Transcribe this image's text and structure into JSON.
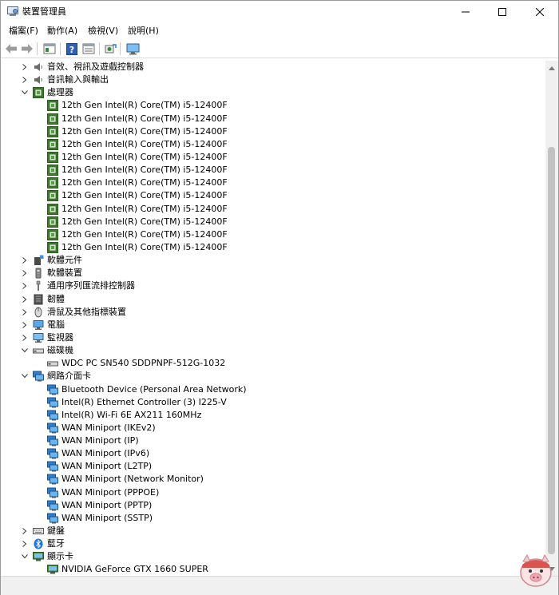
{
  "window": {
    "title": "裝置管理員",
    "minimize_glyph": "—",
    "maximize_glyph": "☐",
    "close_glyph": "✕"
  },
  "menu": [
    "檔案(F)",
    "動作(A)",
    "檢視(V)",
    "說明(H)"
  ],
  "toolbar": {
    "icons": [
      "back-arrow-icon",
      "forward-arrow-icon",
      "properties-icon",
      "help-icon",
      "view-icon",
      "scan-hardware-icon",
      "monitor-icon"
    ]
  },
  "tree": [
    {
      "label": "音效、視訊及遊戲控制器",
      "level": 0,
      "expanded": false,
      "icon": "speaker-icon"
    },
    {
      "label": "音訊輸入與輸出",
      "level": 0,
      "expanded": false,
      "icon": "speaker-icon"
    },
    {
      "label": "處理器",
      "level": 0,
      "expanded": true,
      "icon": "processor-icon"
    },
    {
      "label": "12th Gen Intel(R) Core(TM) i5-12400F",
      "level": 1,
      "icon": "processor-icon"
    },
    {
      "label": "12th Gen Intel(R) Core(TM) i5-12400F",
      "level": 1,
      "icon": "processor-icon"
    },
    {
      "label": "12th Gen Intel(R) Core(TM) i5-12400F",
      "level": 1,
      "icon": "processor-icon"
    },
    {
      "label": "12th Gen Intel(R) Core(TM) i5-12400F",
      "level": 1,
      "icon": "processor-icon"
    },
    {
      "label": "12th Gen Intel(R) Core(TM) i5-12400F",
      "level": 1,
      "icon": "processor-icon"
    },
    {
      "label": "12th Gen Intel(R) Core(TM) i5-12400F",
      "level": 1,
      "icon": "processor-icon"
    },
    {
      "label": "12th Gen Intel(R) Core(TM) i5-12400F",
      "level": 1,
      "icon": "processor-icon"
    },
    {
      "label": "12th Gen Intel(R) Core(TM) i5-12400F",
      "level": 1,
      "icon": "processor-icon"
    },
    {
      "label": "12th Gen Intel(R) Core(TM) i5-12400F",
      "level": 1,
      "icon": "processor-icon"
    },
    {
      "label": "12th Gen Intel(R) Core(TM) i5-12400F",
      "level": 1,
      "icon": "processor-icon"
    },
    {
      "label": "12th Gen Intel(R) Core(TM) i5-12400F",
      "level": 1,
      "icon": "processor-icon"
    },
    {
      "label": "12th Gen Intel(R) Core(TM) i5-12400F",
      "level": 1,
      "icon": "processor-icon"
    },
    {
      "label": "軟體元件",
      "level": 0,
      "expanded": false,
      "icon": "software-component-icon"
    },
    {
      "label": "軟體裝置",
      "level": 0,
      "expanded": false,
      "icon": "software-device-icon"
    },
    {
      "label": "通用序列匯流排控制器",
      "level": 0,
      "expanded": false,
      "icon": "usb-icon"
    },
    {
      "label": "韌體",
      "level": 0,
      "expanded": false,
      "icon": "firmware-icon"
    },
    {
      "label": "滑鼠及其他指標裝置",
      "level": 0,
      "expanded": false,
      "icon": "mouse-icon"
    },
    {
      "label": "電腦",
      "level": 0,
      "expanded": false,
      "icon": "computer-icon"
    },
    {
      "label": "監視器",
      "level": 0,
      "expanded": false,
      "icon": "monitor-icon"
    },
    {
      "label": "磁碟機",
      "level": 0,
      "expanded": true,
      "icon": "disk-drive-icon"
    },
    {
      "label": "WDC PC SN540 SDDPNPF-512G-1032",
      "level": 1,
      "icon": "disk-drive-icon"
    },
    {
      "label": "網路介面卡",
      "level": 0,
      "expanded": true,
      "icon": "network-adapter-icon"
    },
    {
      "label": "Bluetooth Device (Personal Area Network)",
      "level": 1,
      "icon": "network-adapter-icon"
    },
    {
      "label": "Intel(R) Ethernet Controller (3) I225-V",
      "level": 1,
      "icon": "network-adapter-icon"
    },
    {
      "label": "Intel(R) Wi-Fi 6E AX211 160MHz",
      "level": 1,
      "icon": "network-adapter-icon"
    },
    {
      "label": "WAN Miniport (IKEv2)",
      "level": 1,
      "icon": "network-adapter-icon"
    },
    {
      "label": "WAN Miniport (IP)",
      "level": 1,
      "icon": "network-adapter-icon"
    },
    {
      "label": "WAN Miniport (IPv6)",
      "level": 1,
      "icon": "network-adapter-icon"
    },
    {
      "label": "WAN Miniport (L2TP)",
      "level": 1,
      "icon": "network-adapter-icon"
    },
    {
      "label": "WAN Miniport (Network Monitor)",
      "level": 1,
      "icon": "network-adapter-icon"
    },
    {
      "label": "WAN Miniport (PPPOE)",
      "level": 1,
      "icon": "network-adapter-icon"
    },
    {
      "label": "WAN Miniport (PPTP)",
      "level": 1,
      "icon": "network-adapter-icon"
    },
    {
      "label": "WAN Miniport (SSTP)",
      "level": 1,
      "icon": "network-adapter-icon"
    },
    {
      "label": "鍵盤",
      "level": 0,
      "expanded": false,
      "icon": "keyboard-icon"
    },
    {
      "label": "藍牙",
      "level": 0,
      "expanded": false,
      "icon": "bluetooth-icon"
    },
    {
      "label": "顯示卡",
      "level": 0,
      "expanded": true,
      "icon": "display-adapter-icon"
    },
    {
      "label": "NVIDIA GeForce GTX 1660 SUPER",
      "level": 1,
      "icon": "display-adapter-icon"
    }
  ],
  "colors": {
    "processor_green": "#3c7a2e",
    "network_blue": "#2d7fd2",
    "bluetooth_blue": "#1a73e8",
    "scrollbar_thumb": "#c2c2c2"
  }
}
